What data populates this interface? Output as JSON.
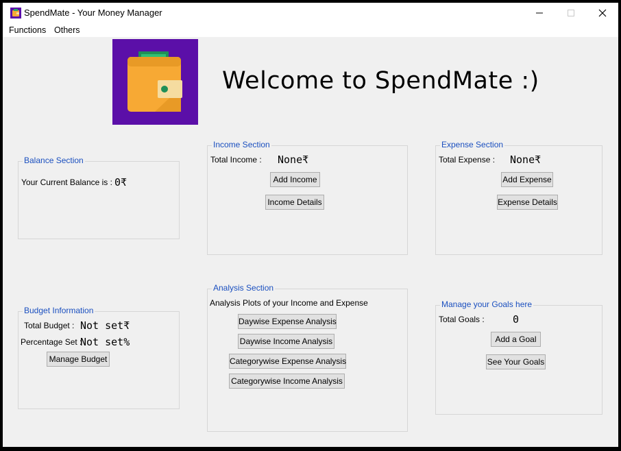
{
  "window": {
    "title": "SpendMate - Your Money Manager"
  },
  "menu": {
    "functions": "Functions",
    "others": "Others"
  },
  "welcome": "Welcome to SpendMate :)",
  "balance": {
    "title": "Balance Section",
    "label": "Your Current Balance is :",
    "value": "0₹"
  },
  "income": {
    "title": "Income Section",
    "label": "Total Income :",
    "value": "None₹",
    "add_button": "Add Income",
    "details_button": "Income Details"
  },
  "expense": {
    "title": "Expense Section",
    "label": "Total Expense :",
    "value": "None₹",
    "add_button": "Add Expense",
    "details_button": "Expense Details"
  },
  "budget": {
    "title": "Budget Information",
    "total_label": "Total Budget :",
    "total_value": "Not set₹",
    "percent_label": "Percentage Set :",
    "percent_value": "Not set%",
    "manage_button": "Manage Budget"
  },
  "analysis": {
    "title": "Analysis Section",
    "subtitle": "Analysis Plots of your Income and Expense",
    "buttons": [
      "Daywise Expense Analysis",
      "Daywise Income Analysis",
      "Categorywise Expense Analysis",
      "Categorywise Income Analysis"
    ]
  },
  "goals": {
    "title": "Manage your Goals here",
    "label": "Total Goals :",
    "value": "0",
    "add_button": "Add a Goal",
    "see_button": "See Your Goals"
  },
  "colors": {
    "logo_bg": "#5b0fa8",
    "wallet": "#f7a934",
    "frame_title": "#1a4fbf"
  }
}
